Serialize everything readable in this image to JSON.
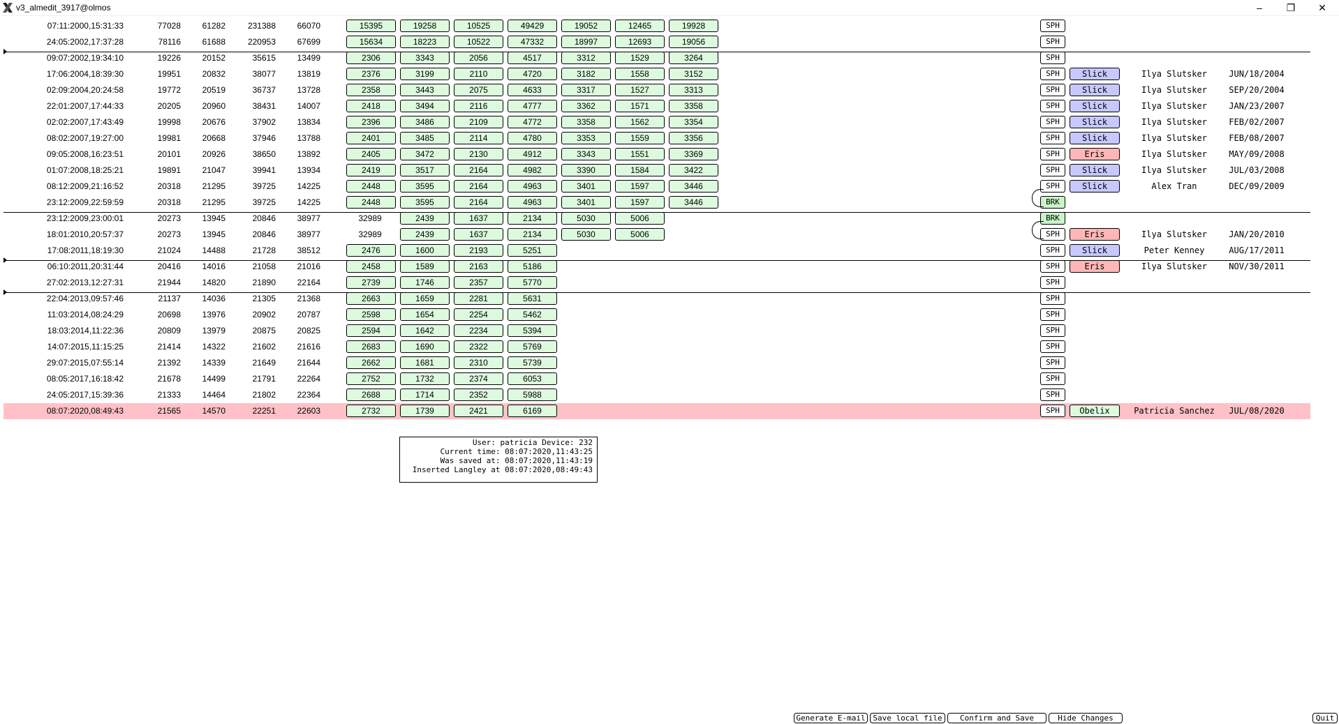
{
  "window": {
    "title": "v3_almedit_3917@olmos",
    "minimize": "–",
    "maximize": "❐",
    "close": "✕"
  },
  "rows": [
    {
      "date": "07:11:2000,15:31:33",
      "nums": [
        "77028",
        "61282",
        "231388",
        "66070"
      ],
      "plain": [],
      "boxes": [
        "15395",
        "19258",
        "10525",
        "49429",
        "19052",
        "12465",
        "19928"
      ],
      "tag": "SPH"
    },
    {
      "date": "24:05:2002,17:37:28",
      "nums": [
        "78116",
        "61688",
        "220953",
        "67699"
      ],
      "plain": [],
      "boxes": [
        "15634",
        "18223",
        "10522",
        "47332",
        "18997",
        "12693",
        "19056"
      ],
      "tag": "SPH"
    },
    {
      "date": "09:07:2002,19:34:10",
      "nums": [
        "19226",
        "20152",
        "35615",
        "13499"
      ],
      "plain": [],
      "boxes": [
        "2306",
        "3343",
        "2056",
        "4517",
        "3312",
        "1529",
        "3264"
      ],
      "tag": "SPH"
    },
    {
      "date": "17:06:2004,18:39:30",
      "nums": [
        "19951",
        "20832",
        "38077",
        "13819"
      ],
      "plain": [],
      "boxes": [
        "2376",
        "3199",
        "2110",
        "4720",
        "3182",
        "1558",
        "3152"
      ],
      "tag": "SPH",
      "status": "Slick",
      "status_color": "blue",
      "person": "Ilya Slutsker",
      "sdate": "JUN/18/2004"
    },
    {
      "date": "02:09:2004,20:24:58",
      "nums": [
        "19772",
        "20519",
        "36737",
        "13728"
      ],
      "plain": [],
      "boxes": [
        "2358",
        "3443",
        "2075",
        "4633",
        "3317",
        "1527",
        "3313"
      ],
      "tag": "SPH",
      "status": "Slick",
      "status_color": "blue",
      "person": "Ilya Slutsker",
      "sdate": "SEP/20/2004"
    },
    {
      "date": "22:01:2007,17:44:33",
      "nums": [
        "20205",
        "20960",
        "38431",
        "14007"
      ],
      "plain": [],
      "boxes": [
        "2418",
        "3494",
        "2116",
        "4777",
        "3362",
        "1571",
        "3358"
      ],
      "tag": "SPH",
      "status": "Slick",
      "status_color": "blue",
      "person": "Ilya Slutsker",
      "sdate": "JAN/23/2007"
    },
    {
      "date": "02:02:2007,17:43:49",
      "nums": [
        "19998",
        "20676",
        "37902",
        "13834"
      ],
      "plain": [],
      "boxes": [
        "2396",
        "3486",
        "2109",
        "4772",
        "3358",
        "1562",
        "3354"
      ],
      "tag": "SPH",
      "status": "Slick",
      "status_color": "blue",
      "person": "Ilya Slutsker",
      "sdate": "FEB/02/2007"
    },
    {
      "date": "08:02:2007,19:27:00",
      "nums": [
        "19981",
        "20668",
        "37946",
        "13788"
      ],
      "plain": [],
      "boxes": [
        "2401",
        "3485",
        "2114",
        "4780",
        "3353",
        "1559",
        "3356"
      ],
      "tag": "SPH",
      "status": "Slick",
      "status_color": "blue",
      "person": "Ilya Slutsker",
      "sdate": "FEB/08/2007"
    },
    {
      "date": "09:05:2008,16:23:51",
      "nums": [
        "20101",
        "20926",
        "38650",
        "13892"
      ],
      "plain": [],
      "boxes": [
        "2405",
        "3472",
        "2130",
        "4912",
        "3343",
        "1551",
        "3369"
      ],
      "tag": "SPH",
      "status": "Eris",
      "status_color": "red",
      "person": "Ilya Slutsker",
      "sdate": "MAY/09/2008"
    },
    {
      "date": "01:07:2008,18:25:21",
      "nums": [
        "19891",
        "21047",
        "39941",
        "13934"
      ],
      "plain": [],
      "boxes": [
        "2419",
        "3517",
        "2164",
        "4982",
        "3390",
        "1584",
        "3422"
      ],
      "tag": "SPH",
      "status": "Slick",
      "status_color": "blue",
      "person": "Ilya Slutsker",
      "sdate": "JUL/03/2008"
    },
    {
      "date": "08:12:2009,21:16:52",
      "nums": [
        "20318",
        "21295",
        "39725",
        "14225"
      ],
      "plain": [],
      "boxes": [
        "2448",
        "3595",
        "2164",
        "4963",
        "3401",
        "1597",
        "3446"
      ],
      "tag": "SPH",
      "status": "Slick",
      "status_color": "blue",
      "person": "Alex Tran",
      "sdate": "DEC/09/2009"
    },
    {
      "date": "23:12:2009,22:59:59",
      "nums": [
        "20318",
        "21295",
        "39725",
        "14225"
      ],
      "plain": [],
      "boxes": [
        "2448",
        "3595",
        "2164",
        "4963",
        "3401",
        "1597",
        "3446"
      ],
      "tag": "BRK"
    },
    {
      "date": "23:12:2009,23:00:01",
      "nums": [
        "20273",
        "13945",
        "20846",
        "38977"
      ],
      "plain": [
        "32989"
      ],
      "boxes": [
        "2439",
        "1637",
        "2134",
        "5030",
        "5006"
      ],
      "tag": "BRK"
    },
    {
      "date": "18:01:2010,20:57:37",
      "nums": [
        "20273",
        "13945",
        "20846",
        "38977"
      ],
      "plain": [
        "32989"
      ],
      "boxes": [
        "2439",
        "1637",
        "2134",
        "5030",
        "5006"
      ],
      "tag": "SPH",
      "status": "Eris",
      "status_color": "red",
      "person": "Ilya Slutsker",
      "sdate": "JAN/20/2010"
    },
    {
      "date": "17:08:2011,18:19:30",
      "nums": [
        "21024",
        "14488",
        "21728",
        "38512"
      ],
      "plain": [],
      "boxes": [
        "2476",
        "1600",
        "2193",
        "5251"
      ],
      "tag": "SPH",
      "status": "Slick",
      "status_color": "blue",
      "person": "Peter Kenney",
      "sdate": "AUG/17/2011"
    },
    {
      "date": "06:10:2011,20:31:44",
      "nums": [
        "20416",
        "14016",
        "21058",
        "21016"
      ],
      "plain": [],
      "boxes": [
        "2458",
        "1589",
        "2163",
        "5186"
      ],
      "tag": "SPH",
      "status": "Eris",
      "status_color": "red",
      "person": "Ilya Slutsker",
      "sdate": "NOV/30/2011"
    },
    {
      "date": "27:02:2013,12:27:31",
      "nums": [
        "21944",
        "14820",
        "21890",
        "22164"
      ],
      "plain": [],
      "boxes": [
        "2739",
        "1746",
        "2357",
        "5770"
      ],
      "tag": "SPH"
    },
    {
      "date": "22:04:2013,09:57:46",
      "nums": [
        "21137",
        "14036",
        "21305",
        "21368"
      ],
      "plain": [],
      "boxes": [
        "2663",
        "1659",
        "2281",
        "5631"
      ],
      "tag": "SPH"
    },
    {
      "date": "11:03:2014,08:24:29",
      "nums": [
        "20698",
        "13976",
        "20902",
        "20787"
      ],
      "plain": [],
      "boxes": [
        "2598",
        "1654",
        "2254",
        "5462"
      ],
      "tag": "SPH"
    },
    {
      "date": "18:03:2014,11:22:36",
      "nums": [
        "20809",
        "13979",
        "20875",
        "20825"
      ],
      "plain": [],
      "boxes": [
        "2594",
        "1642",
        "2234",
        "5394"
      ],
      "tag": "SPH"
    },
    {
      "date": "14:07:2015,11:15:25",
      "nums": [
        "21414",
        "14322",
        "21602",
        "21616"
      ],
      "plain": [],
      "boxes": [
        "2683",
        "1690",
        "2322",
        "5769"
      ],
      "tag": "SPH"
    },
    {
      "date": "29:07:2015,07:55:14",
      "nums": [
        "21392",
        "14339",
        "21649",
        "21644"
      ],
      "plain": [],
      "boxes": [
        "2662",
        "1681",
        "2310",
        "5739"
      ],
      "tag": "SPH"
    },
    {
      "date": "08:05:2017,16:18:42",
      "nums": [
        "21678",
        "14499",
        "21791",
        "22264"
      ],
      "plain": [],
      "boxes": [
        "2752",
        "1732",
        "2374",
        "6053"
      ],
      "tag": "SPH"
    },
    {
      "date": "24:05:2017,15:39:36",
      "nums": [
        "21333",
        "14464",
        "21802",
        "22364"
      ],
      "plain": [],
      "boxes": [
        "2688",
        "1714",
        "2352",
        "5988"
      ],
      "tag": "SPH"
    },
    {
      "date": "08:07:2020,08:49:43",
      "nums": [
        "21565",
        "14570",
        "22251",
        "22603"
      ],
      "plain": [],
      "boxes": [
        "2732",
        "1739",
        "2421",
        "6169"
      ],
      "tag": "SPH",
      "status": "Obelix",
      "status_color": "green",
      "person": "Patricia Sanchez",
      "sdate": "JUL/08/2020",
      "highlight": true
    }
  ],
  "info": {
    "user": "User: patricia Device: 232",
    "current": "Current time: 08:07:2020,11:43:25",
    "saved": "Was saved at: 08:07:2020,11:43:19",
    "inserted": "Inserted Langley at 08:07:2020,08:49:43"
  },
  "buttons": {
    "email": "Generate E-mail",
    "save_local": "Save local file",
    "confirm": "Confirm and Save",
    "hide": "Hide Changes",
    "quit": "Quit"
  }
}
